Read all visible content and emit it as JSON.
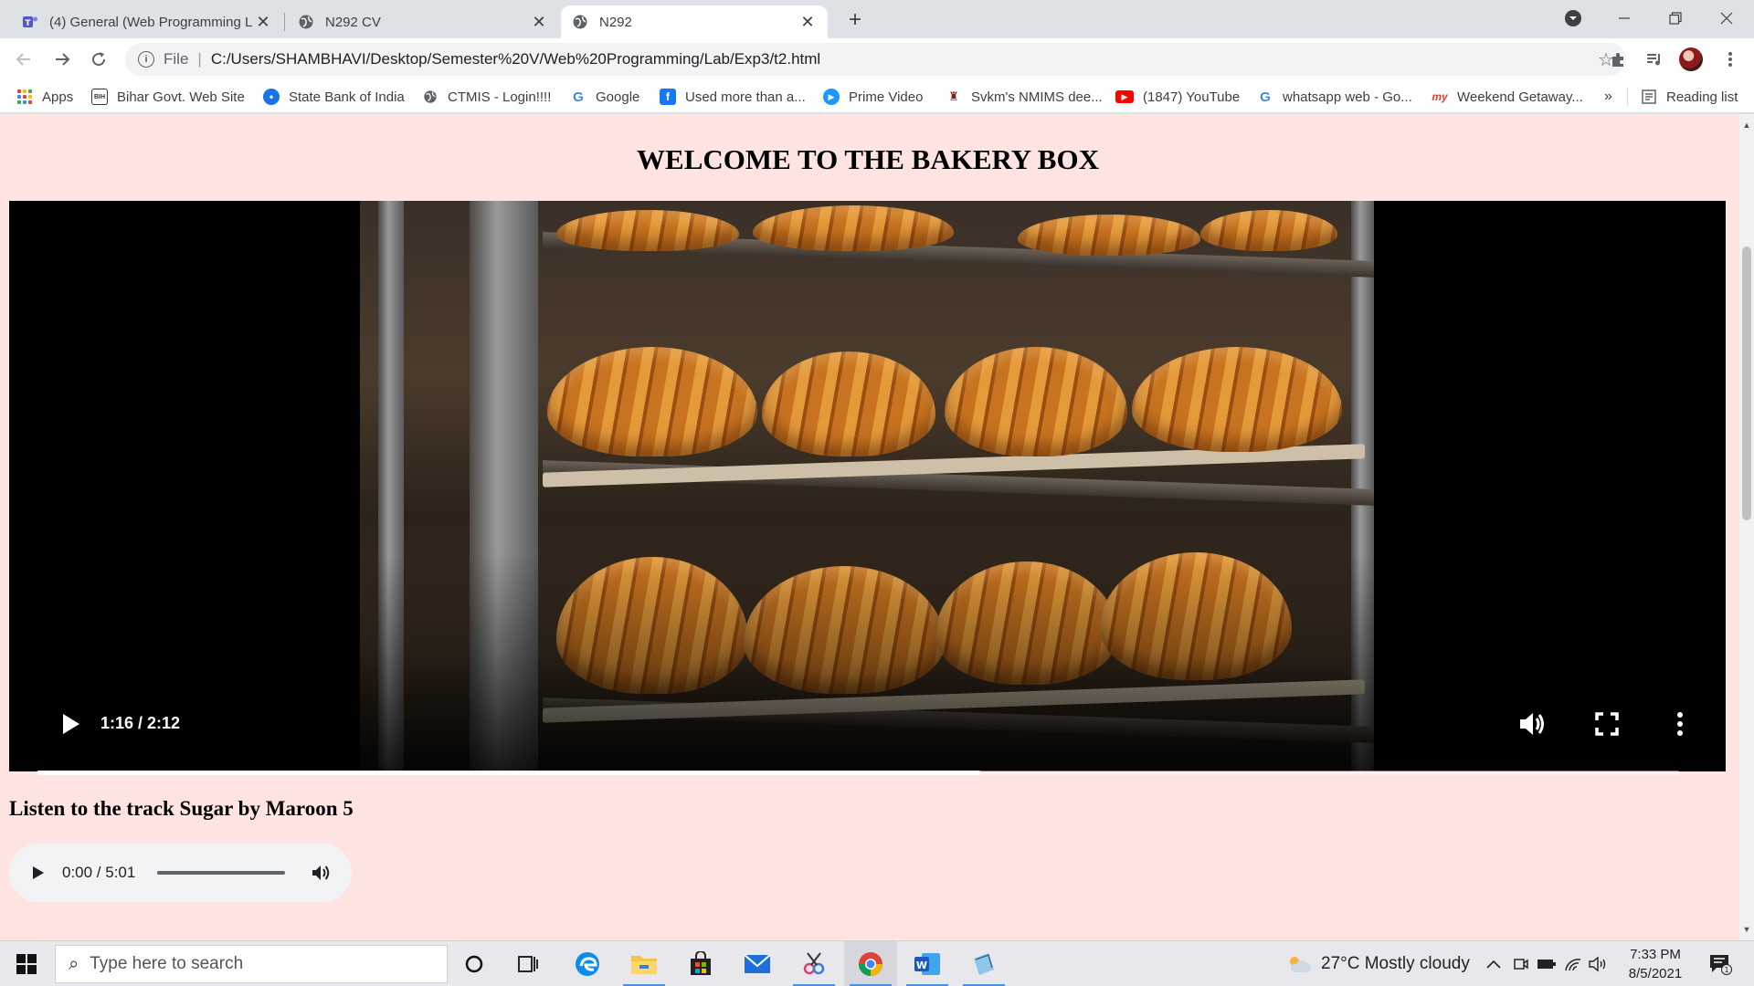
{
  "browser": {
    "tabs": [
      {
        "title": "(4) General (Web Programming L",
        "icon": "teams-icon"
      },
      {
        "title": "N292 CV",
        "icon": "globe-icon"
      },
      {
        "title": "N292",
        "icon": "globe-icon",
        "active": true
      }
    ],
    "address": {
      "scheme_label": "File",
      "url": "C:/Users/SHAMBHAVI/Desktop/Semester%20V/Web%20Programming/Lab/Exp3/t2.html"
    },
    "bookmarks": [
      {
        "label": "Apps",
        "icon": "apps-grid-icon"
      },
      {
        "label": "Bihar Govt. Web Site",
        "icon": "bihar-icon"
      },
      {
        "label": "State Bank of India",
        "icon": "sbi-icon"
      },
      {
        "label": "CTMIS - Login!!!!",
        "icon": "globe-icon"
      },
      {
        "label": "Google",
        "icon": "google-icon"
      },
      {
        "label": "Used more than a...",
        "icon": "facebook-icon"
      },
      {
        "label": "Prime Video",
        "icon": "prime-video-icon"
      },
      {
        "label": "Svkm's NMIMS dee...",
        "icon": "nmims-icon"
      },
      {
        "label": "(1847) YouTube",
        "icon": "youtube-icon"
      },
      {
        "label": "whatsapp web - Go...",
        "icon": "google-icon"
      },
      {
        "label": "Weekend Getaway...",
        "icon": "mmt-icon"
      }
    ],
    "bookmarks_overflow": "»",
    "reading_list": "Reading list"
  },
  "page": {
    "background": "#ffe4e1",
    "title": "WELCOME TO THE BAKERY BOX",
    "video": {
      "time": "1:16 / 2:12",
      "progress_fraction": 0.575
    },
    "audio_heading": "Listen to the track Sugar by Maroon 5",
    "audio": {
      "time": "0:00 / 5:01",
      "progress_fraction": 0.0
    }
  },
  "taskbar": {
    "search_placeholder": "Type here to search",
    "weather": "27°C  Mostly cloudy",
    "time": "7:33 PM",
    "date": "8/5/2021",
    "notification_count": "1"
  }
}
